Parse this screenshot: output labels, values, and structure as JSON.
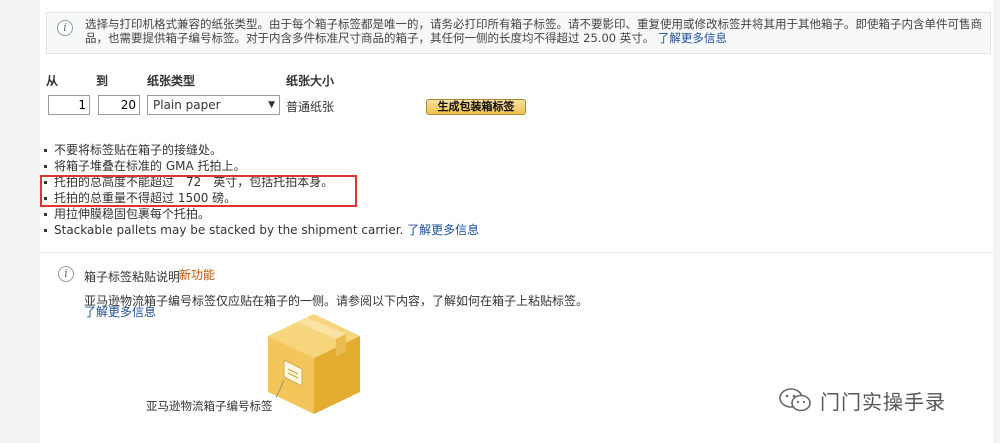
{
  "notice": {
    "icon": "info-icon",
    "text": "选择与打印机格式兼容的纸张类型。由于每个箱子标签都是唯一的，请务必打印所有箱子标签。请不要影印、重复使用或修改标签并将其用于其他箱子。即使箱子内含单件可售商品，也需要提供箱子编号标签。对于内含多件标准尺寸商品的箱子，其任何一侧的长度均不得超过 25.00 英寸。",
    "link": "了解更多信息"
  },
  "form": {
    "from_label": "从",
    "to_label": "到",
    "paper_type_label": "纸张类型",
    "paper_size_label": "纸张大小",
    "from_value": "1",
    "to_value": "20",
    "paper_type_value": "Plain paper",
    "paper_size_value": "普通纸张",
    "generate_button": "生成包装箱标签"
  },
  "rules": [
    "不要将标签贴在箱子的接缝处。",
    "将箱子堆叠在标准的 GMA 托拍上。",
    "托拍的总高度不能超过　72　英寸，包括托拍本身。",
    "托拍的总重量不得超过 1500 磅。",
    "用拉伸膜稳固包裹每个托拍。"
  ],
  "rule_stackable": {
    "text": "Stackable pallets may be stacked by the shipment carrier.",
    "link": "了解更多信息"
  },
  "label_card": {
    "icon": "info-icon",
    "title": "箱子标签粘贴说明",
    "new_badge": "新功能",
    "description": "亚马逊物流箱子编号标签仅应贴在箱子的一侧。请参阅以下内容，了解如何在箱子上粘贴标签。",
    "link": "了解更多信息",
    "illustration_caption": "亚马逊物流箱子编号标签"
  },
  "watermark": {
    "icon": "wechat-logo-icon",
    "text": "门门实操手录"
  },
  "colors": {
    "highlight_border": "#e03434",
    "link": "#1c4f9c",
    "button_top": "#f7dfa5",
    "button_bottom": "#f0c14b",
    "new_badge": "#c45500",
    "box_light": "#f2c65a",
    "box_dark": "#e3ab2f"
  }
}
